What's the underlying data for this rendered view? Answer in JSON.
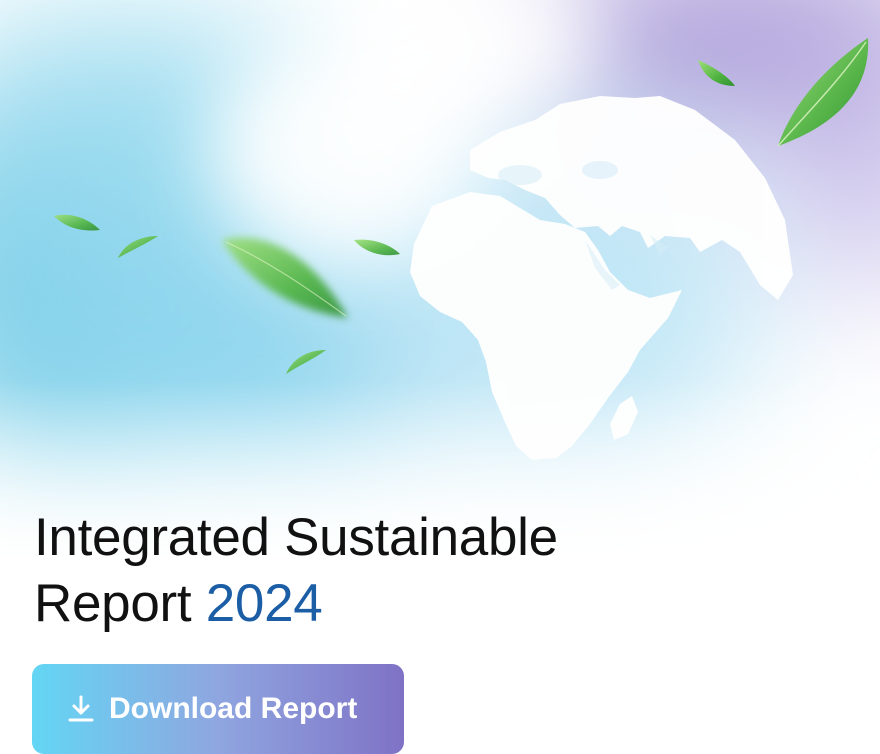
{
  "hero": {
    "title_line1": "Integrated Sustainable",
    "title_line2": "Report",
    "year": "2024"
  },
  "download_button": {
    "label": "Download Report",
    "icon": "download-icon"
  },
  "colors": {
    "title_text": "#111111",
    "year_accent": "#1b5ea6",
    "button_gradient_start": "#63d6f4",
    "button_gradient_end": "#7f72c6",
    "button_text": "#ffffff",
    "leaf_green": "#5cc24a"
  },
  "decor": {
    "background": "globe-icon",
    "leaves": "leaf-icon"
  }
}
